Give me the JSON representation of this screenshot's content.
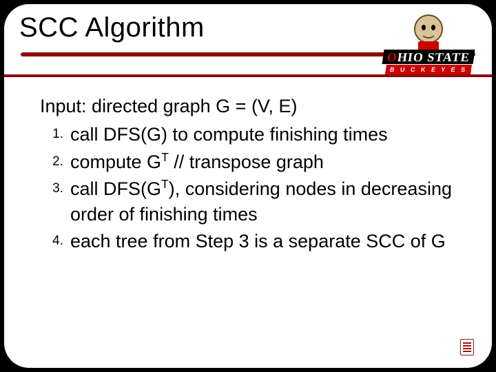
{
  "title": "SCC Algorithm",
  "logo": {
    "line1_prefix": "O",
    "line1_mid": "HIO",
    "line1_suffix": "STATE",
    "sub": "B U C K E Y E S"
  },
  "input_label": "Input:  directed graph G = (V, E)",
  "steps": [
    {
      "num": "1.",
      "text": "call DFS(G) to compute finishing times"
    },
    {
      "num": "2.",
      "text_pre": "compute G",
      "sup": "T",
      "text_post": " // transpose graph"
    },
    {
      "num": "3.",
      "text_pre": "call DFS(G",
      "sup": "T",
      "text_post": "), considering nodes in decreasing order of finishing times"
    },
    {
      "num": "4.",
      "text": "each tree from Step 3 is a separate SCC of G"
    }
  ]
}
